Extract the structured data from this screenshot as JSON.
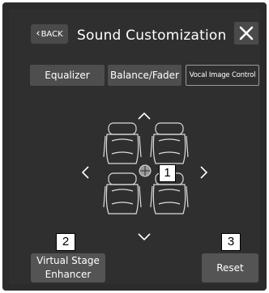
{
  "header": {
    "back_label": "BACK",
    "title": "Sound Customization"
  },
  "tabs": [
    {
      "label": "Equalizer",
      "selected": false
    },
    {
      "label": "Balance/Fader",
      "selected": false
    },
    {
      "label": "Vocal Image Control",
      "selected": true
    }
  ],
  "callouts": {
    "one": "1",
    "two": "2",
    "three": "3"
  },
  "buttons": {
    "virtual_stage_line1": "Virtual Stage",
    "virtual_stage_line2": "Enhancer",
    "reset": "Reset"
  },
  "icons": {
    "back": "chevron-left-icon",
    "close": "close-icon",
    "up": "chevron-up-icon",
    "down": "chevron-down-icon",
    "left": "chevron-left-icon",
    "right": "chevron-right-icon",
    "seats": "car-seats-icon",
    "position": "listening-position-icon"
  },
  "colors": {
    "background": "#2b2b2b",
    "button": "#545454",
    "text": "#ffffff"
  }
}
